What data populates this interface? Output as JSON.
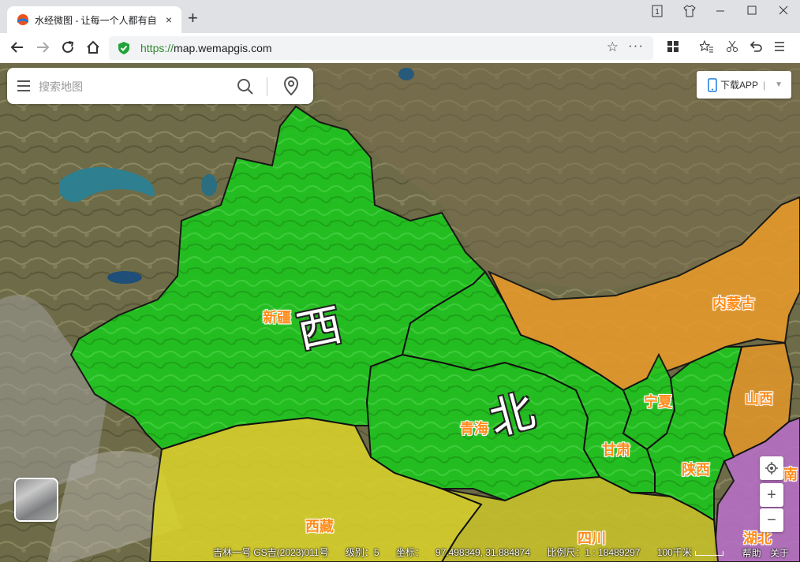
{
  "browser": {
    "tab_title": "水经微图 - 让每一个人都有自",
    "tab_close": "×",
    "new_tab": "+",
    "url_scheme": "https://",
    "url_host": "map.wemapgis.com",
    "tab_count": "1"
  },
  "search": {
    "placeholder": "搜索地图"
  },
  "app_button": {
    "label": "下载APP",
    "separator": "|"
  },
  "map": {
    "region_labels": {
      "xinjiang": "新疆",
      "qinghai": "青海",
      "gansu": "甘肃",
      "ningxia": "宁夏",
      "shaanxi": "陕西",
      "neimenggu": "内蒙古",
      "shanxi": "山西",
      "xizang": "西藏",
      "sichuan": "四川",
      "hubei": "湖北",
      "henan_partial": "南"
    },
    "big_labels": {
      "xi": "西",
      "bei": "北"
    },
    "colors": {
      "highlight": "#1ec41e",
      "neimenggu": "#e89a2a",
      "xizang": "#d9d22a",
      "hubei": "#c070c8",
      "label_text": "#ff8c1a"
    }
  },
  "controls": {
    "zoom_in": "+",
    "zoom_out": "−"
  },
  "status": {
    "attribution": "吉林一号 GS吉(2023)011号",
    "level_label": "级别：",
    "level_value": "5",
    "coord_label": "坐标：",
    "coord_value": "97.498349, 31.884874",
    "scale_label": "比例尺：",
    "scale_value": "1 : 18489297",
    "scale_bar_text": "100千米",
    "help": "帮助",
    "about": "关于"
  }
}
